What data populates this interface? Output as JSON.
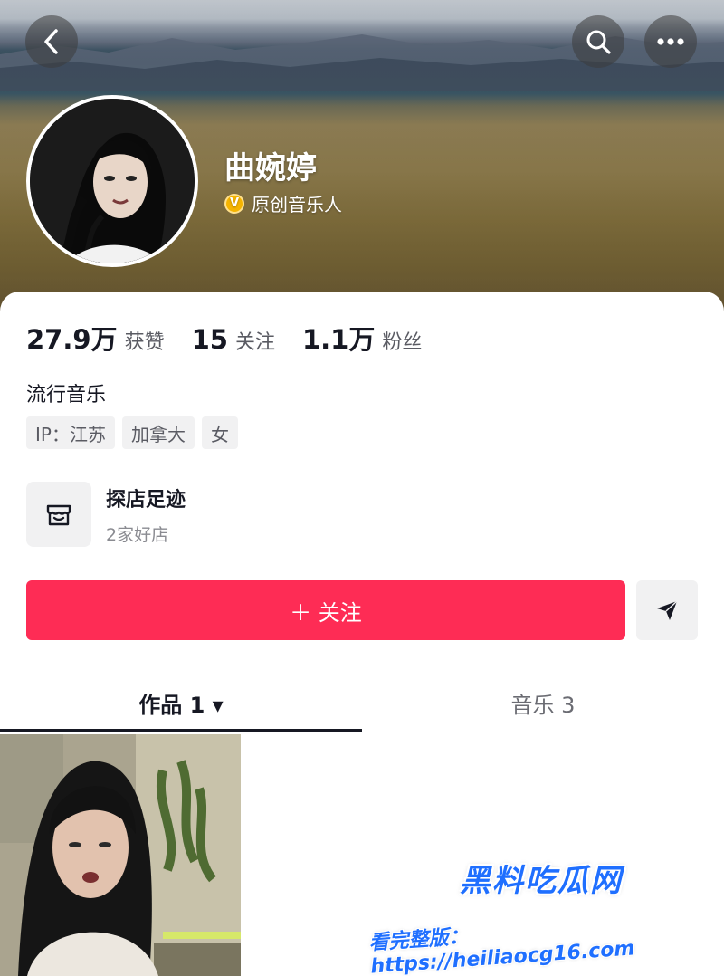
{
  "header": {
    "back_icon": "chevron-left-icon",
    "search_icon": "search-icon",
    "more_icon": "more-horizontal-icon"
  },
  "profile": {
    "name": "曲婉婷",
    "verified_badge": "V",
    "verified_label": "原创音乐人",
    "bio": "流行音乐",
    "stats": [
      {
        "value": "27.9万",
        "label": "获赞"
      },
      {
        "value": "15",
        "label": "关注"
      },
      {
        "value": "1.1万",
        "label": "粉丝"
      }
    ],
    "tags": [
      "IP：江苏",
      "加拿大",
      "女"
    ]
  },
  "store": {
    "icon": "store-icon",
    "title": "探店足迹",
    "subtitle": "2家好店"
  },
  "actions": {
    "follow_label": "＋ 关注",
    "share_icon": "send-icon"
  },
  "tabs": [
    {
      "label": "作品 1 ▾",
      "active": true
    },
    {
      "label": "音乐 3",
      "active": false
    }
  ],
  "watermark": {
    "logo": "黑料吃瓜网",
    "url": "看完整版：https://heiliaocg16.com"
  },
  "colors": {
    "accent": "#fe2c55",
    "text_primary": "#161823",
    "text_secondary": "#5a5b63",
    "verified": "#f5b400"
  }
}
